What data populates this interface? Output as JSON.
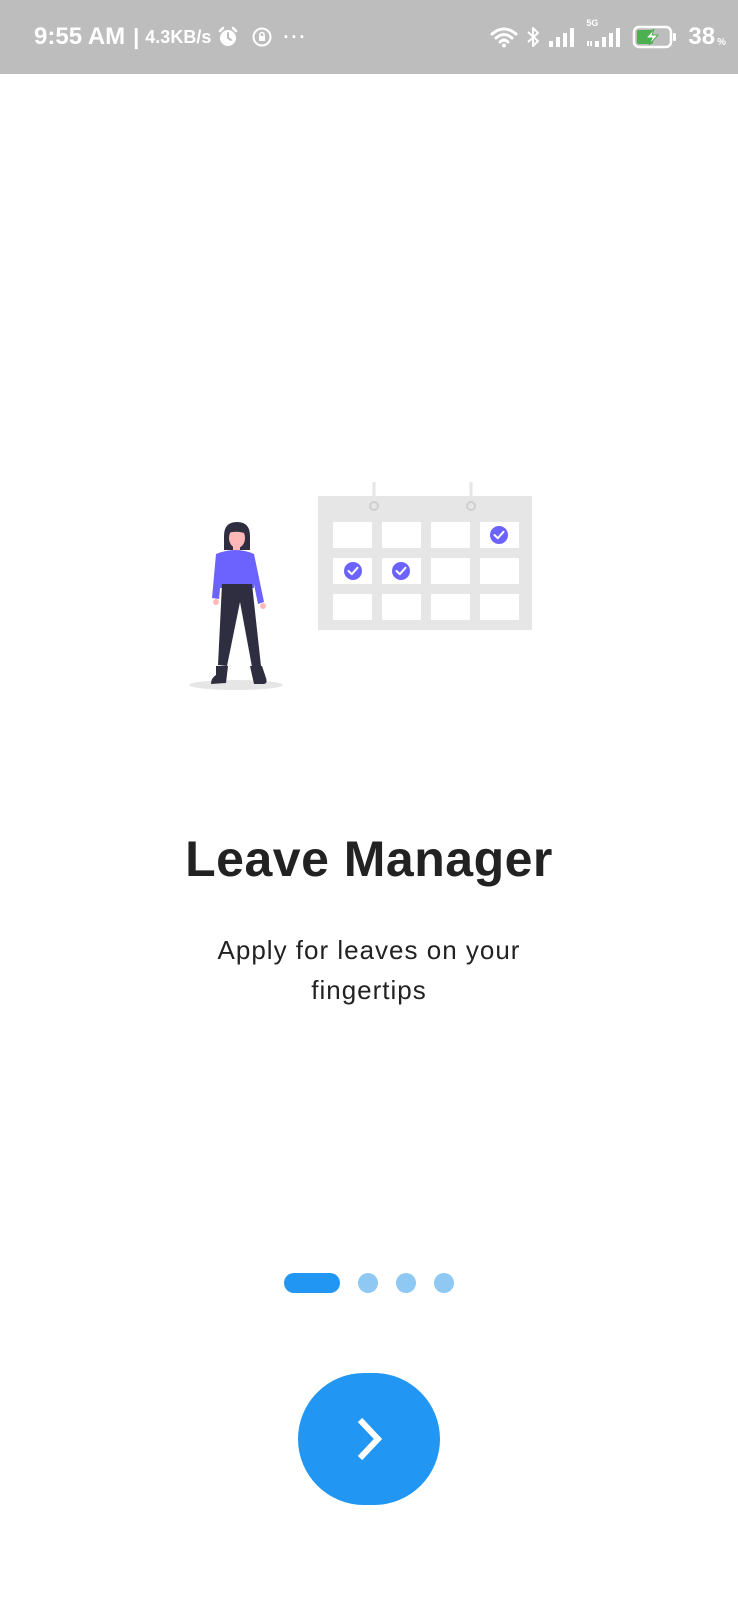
{
  "status_bar": {
    "time": "9:55 AM",
    "separator": "|",
    "network_speed": "4.3KB/s",
    "more_indicator": "···",
    "network_label": "5G",
    "battery_percent": "38",
    "battery_unit": "%",
    "icons": [
      "alarm-icon",
      "lock-rotation-icon",
      "wifi-icon",
      "bluetooth-icon",
      "signal-icon",
      "5g-signal-icon",
      "battery-charging-icon"
    ]
  },
  "onboarding": {
    "title": "Leave Manager",
    "subtitle": "Apply for leaves on your fingertips",
    "page_count": 4,
    "current_page": 1,
    "illustration": "woman-with-calendar-illustration"
  },
  "next_button": {
    "icon": "chevron-right-icon"
  },
  "colors": {
    "status_bar_bg": "#bdbdbd",
    "accent": "#2196f3",
    "dot_inactive": "#90c8f4",
    "illustration_purple": "#6c63ff",
    "calendar_gray": "#e6e6e6",
    "text": "#222222"
  }
}
